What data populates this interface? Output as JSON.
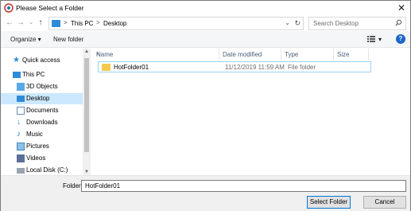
{
  "window": {
    "title": "Please Select a Folder",
    "close_glyph": "✕"
  },
  "navigation": {
    "back_glyph": "←",
    "forward_glyph": "→",
    "recent_glyph": "⌄",
    "up_glyph": "↑"
  },
  "address": {
    "separator": ">",
    "segments": [
      "This PC",
      "Desktop"
    ],
    "dropdown_glyph": "⌄",
    "refresh_glyph": "↻"
  },
  "search": {
    "placeholder": "Search Desktop",
    "icon": "search-icon"
  },
  "toolbar": {
    "organize_label": "Organize ▾",
    "new_folder_label": "New folder",
    "view_icon": "view-options-icon",
    "view_dropdown": "▾",
    "help_label": "?"
  },
  "sidebar": {
    "items": [
      {
        "label": "Quick access",
        "icon": "star-icon"
      },
      {
        "label": "This PC",
        "icon": "computer-icon"
      },
      {
        "label": "3D Objects",
        "icon": "cube-icon"
      },
      {
        "label": "Desktop",
        "icon": "desktop-icon",
        "selected": true
      },
      {
        "label": "Documents",
        "icon": "document-icon"
      },
      {
        "label": "Downloads",
        "icon": "download-icon"
      },
      {
        "label": "Music",
        "icon": "music-icon"
      },
      {
        "label": "Pictures",
        "icon": "picture-icon"
      },
      {
        "label": "Videos",
        "icon": "video-icon"
      },
      {
        "label": "Local Disk (C:)",
        "icon": "drive-icon"
      }
    ]
  },
  "file_list": {
    "columns": [
      "Name",
      "Date modified",
      "Type",
      "Size"
    ],
    "sort_glyph": "˄",
    "rows": [
      {
        "name": "HotFolder01",
        "date_modified": "11/12/2019 11:59 AM",
        "type": "File folder",
        "size": ""
      }
    ]
  },
  "footer": {
    "folder_label": "Folder:",
    "folder_value": "HotFolder01",
    "select_button": "Select Folder",
    "cancel_button": "Cancel"
  },
  "colors": {
    "selection": "#cce8ff",
    "accent": "#0078d7",
    "folder": "#f5c94e"
  }
}
